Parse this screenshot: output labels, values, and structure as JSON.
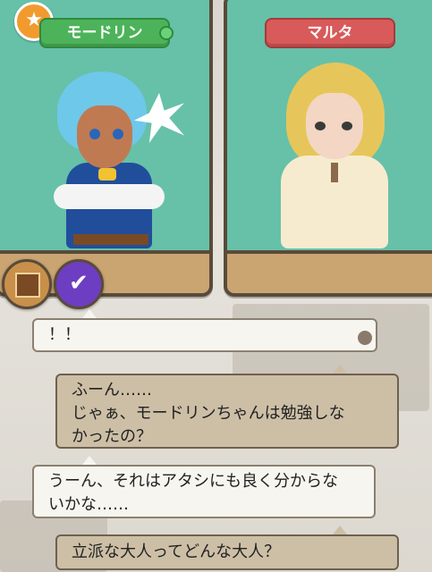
{
  "characters": {
    "left": {
      "name": "モードリン",
      "badge_icon": "star-icon"
    },
    "right": {
      "name": "マルタ"
    }
  },
  "skills": [
    {
      "icon": "bookshelf-icon"
    },
    {
      "icon": "checkmark-icon"
    }
  ],
  "dialogue": [
    {
      "speaker": "player",
      "text": "！！"
    },
    {
      "speaker": "npc",
      "lines": [
        "ふーん……",
        "じゃぁ、モードリンちゃんは勉強しな",
        "かったの？"
      ]
    },
    {
      "speaker": "player",
      "lines": [
        "うーん、それはアタシにも良く分からな",
        "いかな……"
      ]
    },
    {
      "speaker": "npc",
      "text": "立派な大人ってどんな大人？"
    }
  ],
  "colors": {
    "portrait_bg": "#66c1a8",
    "left_nameplate": "#4db35a",
    "right_nameplate": "#d85a5a",
    "badge": "#f29a2e"
  }
}
